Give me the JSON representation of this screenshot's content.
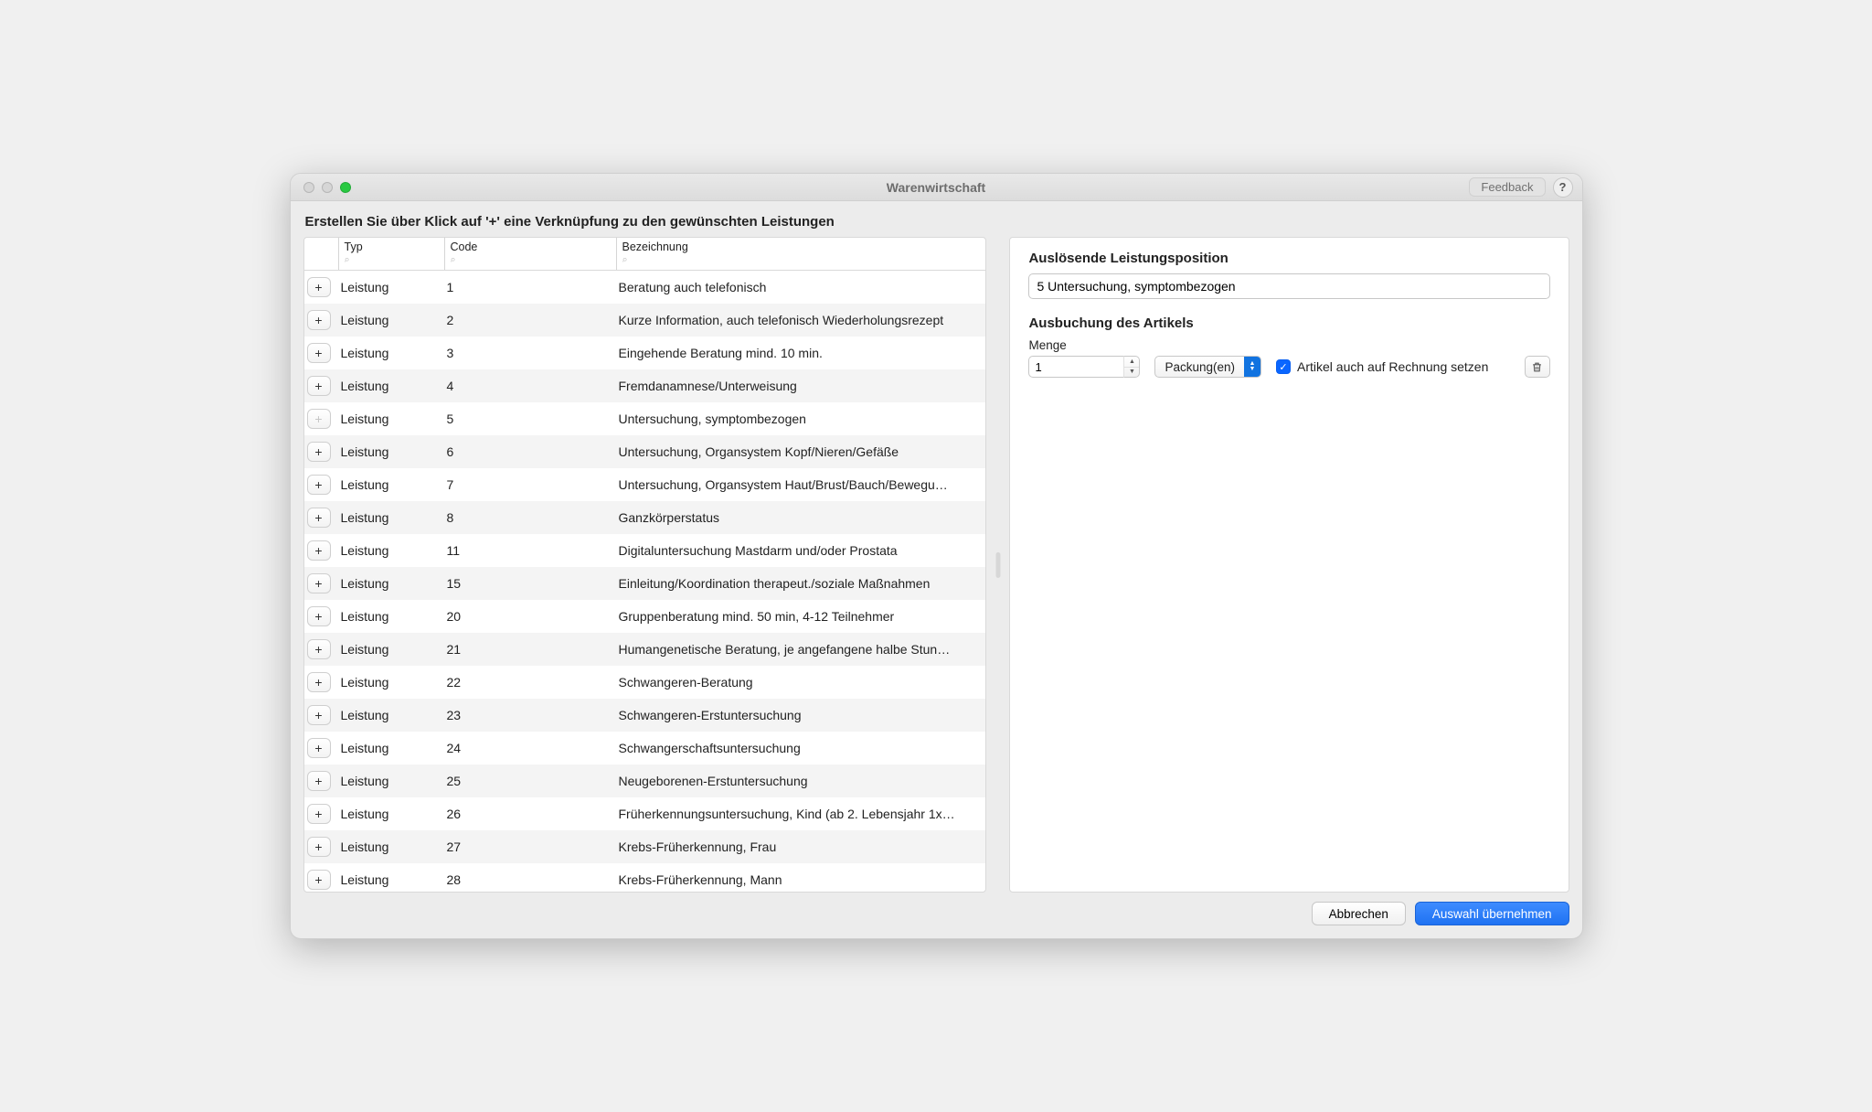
{
  "window": {
    "title": "Warenwirtschaft",
    "feedback": "Feedback",
    "help": "?"
  },
  "instruction": "Erstellen Sie über Klick auf '+' eine Verknüpfung zu den gewünschten Leistungen",
  "table": {
    "headers": {
      "typ": "Typ",
      "code": "Code",
      "bez": "Bezeichnung"
    },
    "filter_placeholder": "⌕",
    "rows": [
      {
        "typ": "Leistung",
        "code": "1",
        "bez": "Beratung auch telefonisch",
        "add_enabled": true
      },
      {
        "typ": "Leistung",
        "code": "2",
        "bez": "Kurze Information, auch telefonisch Wiederholungsrezept",
        "add_enabled": true
      },
      {
        "typ": "Leistung",
        "code": "3",
        "bez": "Eingehende Beratung mind. 10 min.",
        "add_enabled": true
      },
      {
        "typ": "Leistung",
        "code": "4",
        "bez": "Fremdanamnese/Unterweisung",
        "add_enabled": true
      },
      {
        "typ": "Leistung",
        "code": "5",
        "bez": "Untersuchung, symptombezogen",
        "add_enabled": false
      },
      {
        "typ": "Leistung",
        "code": "6",
        "bez": "Untersuchung, Organsystem Kopf/Nieren/Gefäße",
        "add_enabled": true
      },
      {
        "typ": "Leistung",
        "code": "7",
        "bez": "Untersuchung, Organsystem Haut/Brust/Bauch/Bewegu…",
        "add_enabled": true
      },
      {
        "typ": "Leistung",
        "code": "8",
        "bez": "Ganzkörperstatus",
        "add_enabled": true
      },
      {
        "typ": "Leistung",
        "code": "11",
        "bez": "Digitaluntersuchung Mastdarm und/oder Prostata",
        "add_enabled": true
      },
      {
        "typ": "Leistung",
        "code": "15",
        "bez": "Einleitung/Koordination therapeut./soziale Maßnahmen",
        "add_enabled": true
      },
      {
        "typ": "Leistung",
        "code": "20",
        "bez": "Gruppenberatung mind. 50 min, 4-12 Teilnehmer",
        "add_enabled": true
      },
      {
        "typ": "Leistung",
        "code": "21",
        "bez": "Humangenetische Beratung, je angefangene halbe Stun…",
        "add_enabled": true
      },
      {
        "typ": "Leistung",
        "code": "22",
        "bez": "Schwangeren-Beratung",
        "add_enabled": true
      },
      {
        "typ": "Leistung",
        "code": "23",
        "bez": "Schwangeren-Erstuntersuchung",
        "add_enabled": true
      },
      {
        "typ": "Leistung",
        "code": "24",
        "bez": "Schwangerschaftsuntersuchung",
        "add_enabled": true
      },
      {
        "typ": "Leistung",
        "code": "25",
        "bez": "Neugeborenen-Erstuntersuchung",
        "add_enabled": true
      },
      {
        "typ": "Leistung",
        "code": "26",
        "bez": "Früherkennungsuntersuchung, Kind (ab 2. Lebensjahr 1x…",
        "add_enabled": true
      },
      {
        "typ": "Leistung",
        "code": "27",
        "bez": "Krebs-Früherkennung, Frau",
        "add_enabled": true
      },
      {
        "typ": "Leistung",
        "code": "28",
        "bez": "Krebs-Früherkennung, Mann",
        "add_enabled": true
      }
    ]
  },
  "detail": {
    "trigger_label": "Auslösende Leistungsposition",
    "trigger_value": "5 Untersuchung, symptombezogen",
    "booking_label": "Ausbuchung des Artikels",
    "qty_label": "Menge",
    "qty_value": "1",
    "unit_value": "Packung(en)",
    "invoice_checkbox_label": "Artikel auch auf Rechnung setzen",
    "invoice_checked": true
  },
  "footer": {
    "cancel": "Abbrechen",
    "apply": "Auswahl übernehmen"
  }
}
